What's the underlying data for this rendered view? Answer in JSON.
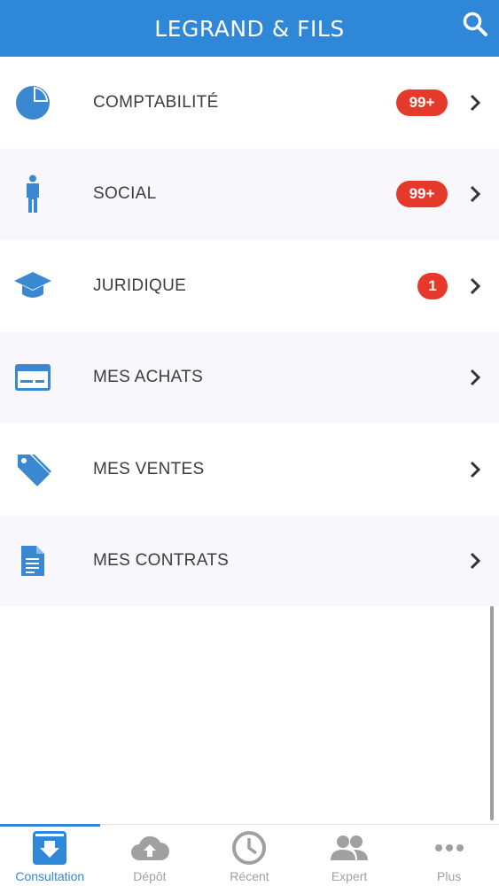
{
  "header": {
    "title": "LEGRAND & FILS",
    "search_icon": "search-icon",
    "background": "#2f87d8"
  },
  "menu": {
    "items": [
      {
        "label": "COMPTABILITÉ",
        "icon": "pie-chart-icon",
        "badge": "99+"
      },
      {
        "label": "SOCIAL",
        "icon": "person-icon",
        "badge": "99+"
      },
      {
        "label": "JURIDIQUE",
        "icon": "graduation-cap-icon",
        "badge": "1"
      },
      {
        "label": "MES ACHATS",
        "icon": "credit-card-icon",
        "badge": ""
      },
      {
        "label": "MES VENTES",
        "icon": "tags-icon",
        "badge": ""
      },
      {
        "label": "MES CONTRATS",
        "icon": "document-icon",
        "badge": ""
      }
    ]
  },
  "colors": {
    "accent": "#2f87d8",
    "badge": "#e53a2b",
    "inactive_tab": "#a0a0a0"
  },
  "tabbar": {
    "tabs": [
      {
        "label": "Consultation",
        "icon": "inbox-download-icon",
        "active": true
      },
      {
        "label": "Dépôt",
        "icon": "cloud-upload-icon",
        "active": false
      },
      {
        "label": "Récent",
        "icon": "clock-icon",
        "active": false
      },
      {
        "label": "Expert",
        "icon": "people-icon",
        "active": false
      },
      {
        "label": "Plus",
        "icon": "more-dots-icon",
        "active": false
      }
    ]
  }
}
